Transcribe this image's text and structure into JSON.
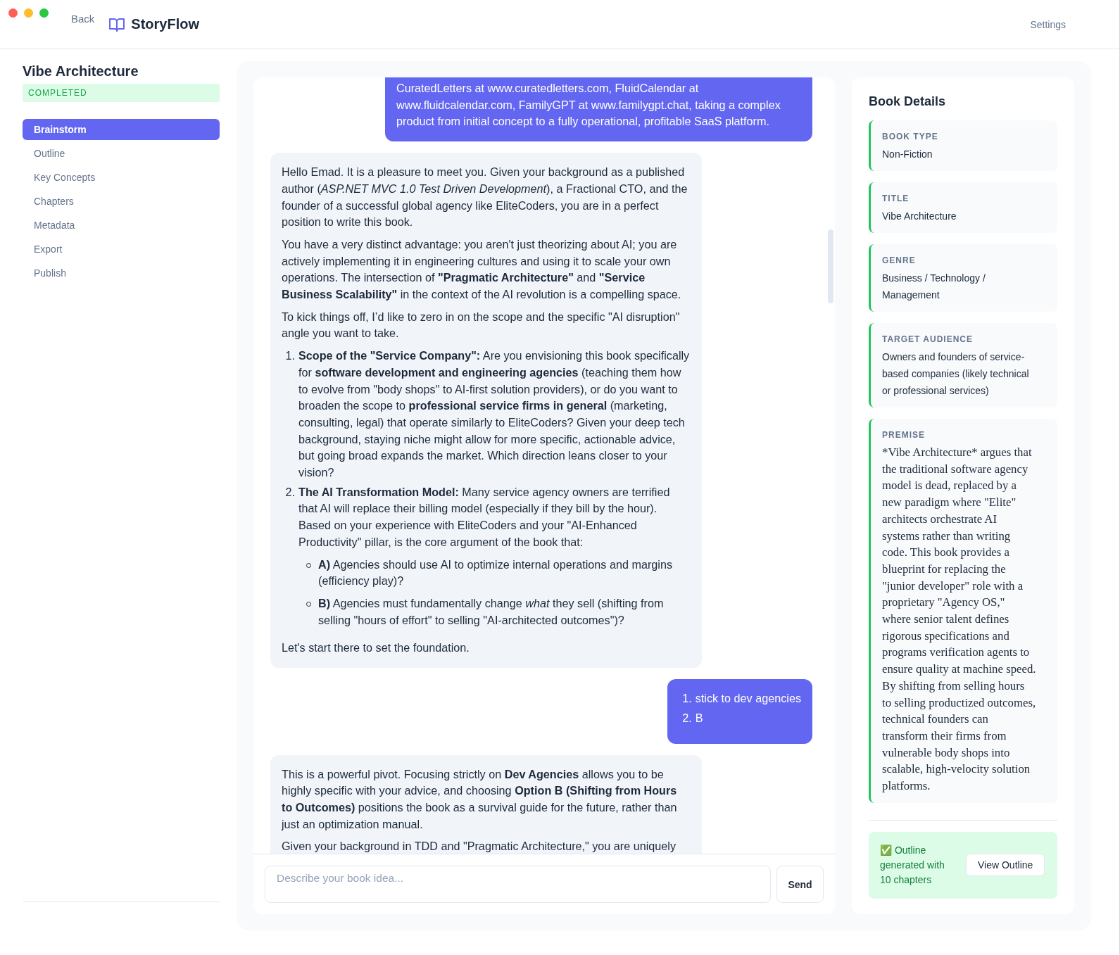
{
  "window": {
    "back": "Back",
    "app_name": "StoryFlow",
    "settings": "Settings"
  },
  "sidebar": {
    "title": "Vibe Architecture",
    "status": "COMPLETED",
    "items": [
      {
        "label": "Brainstorm",
        "selected": true
      },
      {
        "label": "Outline",
        "selected": false
      },
      {
        "label": "Key Concepts",
        "selected": false
      },
      {
        "label": "Chapters",
        "selected": false
      },
      {
        "label": "Metadata",
        "selected": false
      },
      {
        "label": "Export",
        "selected": false
      },
      {
        "label": "Publish",
        "selected": false
      }
    ]
  },
  "chat": {
    "messages": [
      {
        "kind": "user",
        "blocks": [
          {
            "kind": "p",
            "text": "CuratedLetters at www.curatedletters.com, FluidCalendar at www.fluidcalendar.com, FamilyGPT at www.familygpt.chat, taking a complex product from initial concept to a fully operational, profitable SaaS platform."
          }
        ]
      },
      {
        "kind": "assistant",
        "blocks": [
          {
            "kind": "p",
            "text": "Hello Emad. It is a pleasure to meet you. Given your background as a published author (*ASP.NET MVC 1.0 Test Driven Development*), a Fractional CTO, and the founder of a successful global agency like EliteCoders, you are in a perfect position to write this book."
          },
          {
            "kind": "p",
            "text": "You have a very distinct advantage: you aren't just theorizing about AI; you are actively implementing it in engineering cultures and using it to scale your own operations. The intersection of **\"Pragmatic Architecture\"** and **\"Service Business Scalability\"** in the context of the AI revolution is a compelling space."
          },
          {
            "kind": "p",
            "text": "To kick things off, I’d like to zero in on the scope and the specific \"AI disruption\" angle you want to take."
          },
          {
            "kind": "ol",
            "items": [
              {
                "number": "1.",
                "text": "**Scope of the \"Service Company\":** Are you envisioning this book specifically for **software development and engineering agencies** (teaching them how to evolve from \"body shops\" to AI-first solution providers), or do you want to broaden the scope to **professional service firms in general** (marketing, consulting, legal) that operate similarly to EliteCoders? Given your deep tech background, staying niche might allow for more specific, actionable advice, but going broad expands the market. Which direction leans closer to your vision?"
              },
              {
                "number": "2.",
                "text": "**The AI Transformation Model:** Many service agency owners are terrified that AI will replace their billing model (especially if they bill by the hour). Based on your experience with EliteCoders and your \"AI-Enhanced Productivity\" pillar, is the core argument of the book that:",
                "children": [
                  {
                    "text": "**A)** Agencies should use AI to optimize internal operations and margins (efficiency play)?"
                  },
                  {
                    "text": "**B)** Agencies must fundamentally change *what* they sell (shifting from selling \"hours of effort\" to selling \"AI-architected outcomes\")?"
                  }
                ]
              }
            ]
          },
          {
            "kind": "p",
            "text": "Let's start there to set the foundation."
          }
        ]
      },
      {
        "kind": "user",
        "blocks": [
          {
            "kind": "ol",
            "items": [
              {
                "number": "1.",
                "text": "stick to dev agencies"
              },
              {
                "number": "2.",
                "text": "B"
              }
            ]
          }
        ]
      },
      {
        "kind": "assistant",
        "blocks": [
          {
            "kind": "p",
            "text": "This is a powerful pivot. Focusing strictly on **Dev Agencies** allows you to be highly specific with your advice, and choosing **Option B (Shifting from Hours to Outcomes)** positions the book as a survival guide for the future, rather than just an optimization manual."
          },
          {
            "kind": "p",
            "text": "Given your background in TDD and \"Pragmatic Architecture,\" you are uniquely"
          }
        ]
      }
    ],
    "input": {
      "placeholder": "Describe your book idea..."
    },
    "send": "Send"
  },
  "details": {
    "title": "Book Details",
    "fields": [
      {
        "label": "BOOK TYPE",
        "value": "Non-Fiction",
        "kind": "plain"
      },
      {
        "label": "TITLE",
        "value": "Vibe Architecture",
        "kind": "plain"
      },
      {
        "label": "GENRE",
        "value": "Business / Technology / Management",
        "kind": "plain"
      },
      {
        "label": "TARGET AUDIENCE",
        "value": "Owners and founders of service-based companies (likely technical or professional services)",
        "kind": "plain"
      },
      {
        "label": "PREMISE",
        "value": "*Vibe Architecture* argues that the traditional software agency model is dead, replaced by a new paradigm where \"Elite\" architects orchestrate AI systems rather than writing code. This book provides a blueprint for replacing the \"junior developer\" role with a proprietary \"Agency OS,\" where senior talent defines rigorous specifications and programs verification agents to ensure quality at machine speed. By shifting from selling hours to selling productized outcomes, technical founders can transform their firms from vulnerable body shops into scalable, high-velocity solution platforms.",
        "kind": "serif"
      }
    ],
    "notice": {
      "icon": "✅",
      "text": "Outline generated with 10 chapters",
      "button": "View Outline"
    }
  }
}
